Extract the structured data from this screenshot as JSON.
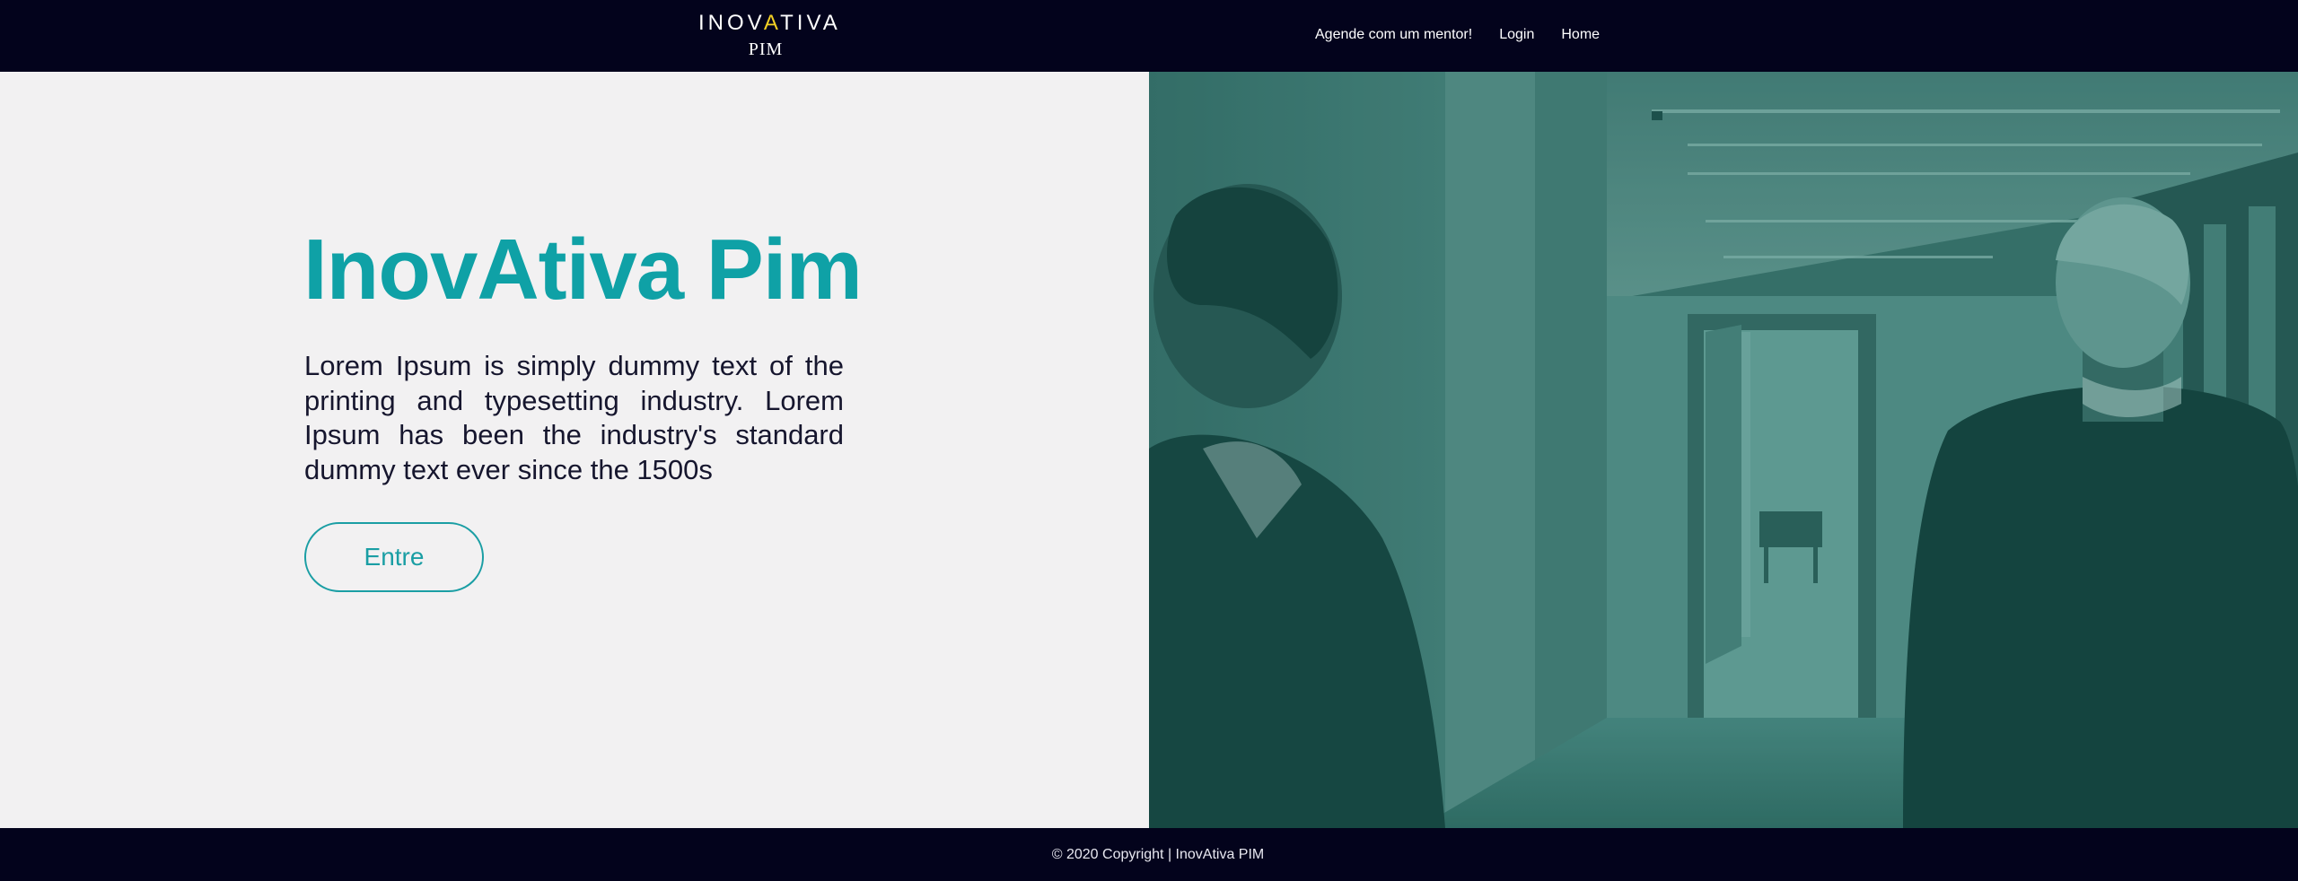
{
  "header": {
    "logo": {
      "top_before": "INOV",
      "top_accent": "A",
      "top_after": "TIVA",
      "bottom": "PIM"
    },
    "nav": [
      {
        "label": "Agende com um mentor!"
      },
      {
        "label": "Login"
      },
      {
        "label": "Home"
      }
    ]
  },
  "hero": {
    "title": "InovAtiva Pim",
    "text": "Lorem Ipsum is simply dummy text of the printing and typesetting industry. Lorem Ipsum has been the industry's standard dummy text ever since the 1500s",
    "button_label": "Entre"
  },
  "footer": {
    "copyright": "© 2020 Copyright | InovAtiva PIM"
  },
  "colors": {
    "navbar_bg": "#03031c",
    "accent_teal": "#0fa1a6",
    "logo_accent": "#f2cf24",
    "photo_tint": "#2f6b66"
  }
}
